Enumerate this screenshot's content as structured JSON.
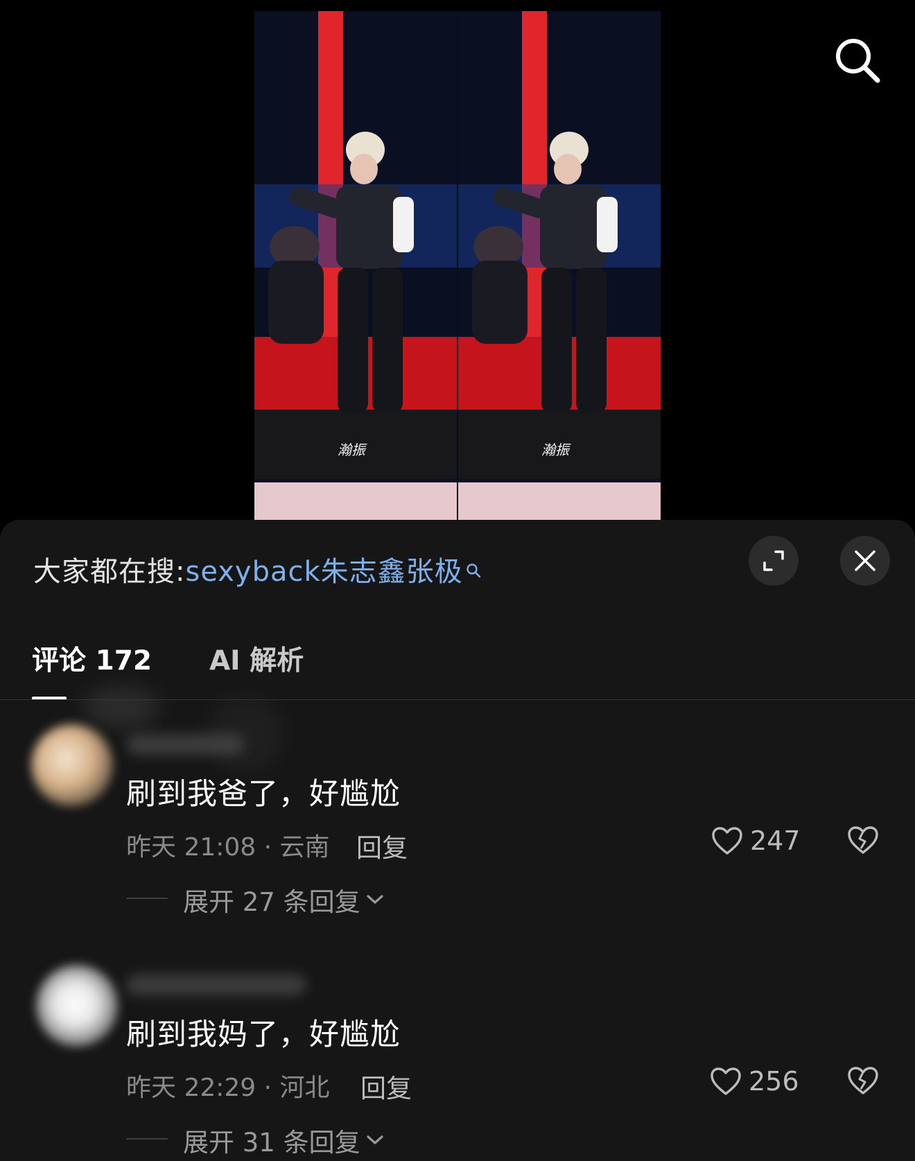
{
  "top_bar": {
    "search_icon": "search-icon"
  },
  "video": {
    "watermark": "瀚振"
  },
  "panel": {
    "hot_search_label": "大家都在搜:",
    "hot_search_term": "sexyback朱志鑫张极",
    "expand_icon": "expand-icon",
    "close_icon": "close-icon"
  },
  "tabs": [
    {
      "label": "评论 172",
      "active": true
    },
    {
      "label": "AI 解析",
      "active": false
    }
  ],
  "comments": [
    {
      "text": "刷到我爸了，好尴尬",
      "meta": "昨天 21:08 · 云南",
      "reply_label": "回复",
      "likes": "247",
      "expand_label": "展开 27 条回复"
    },
    {
      "text": "刷到我妈了，好尴尬",
      "meta": "昨天 22:29 · 河北",
      "reply_label": "回复",
      "likes": "256",
      "expand_label": "展开 31 条回复"
    }
  ],
  "colors": {
    "accent_link": "#7fb0ee",
    "panel_bg": "#161616",
    "stage_red": "#e0262a"
  }
}
